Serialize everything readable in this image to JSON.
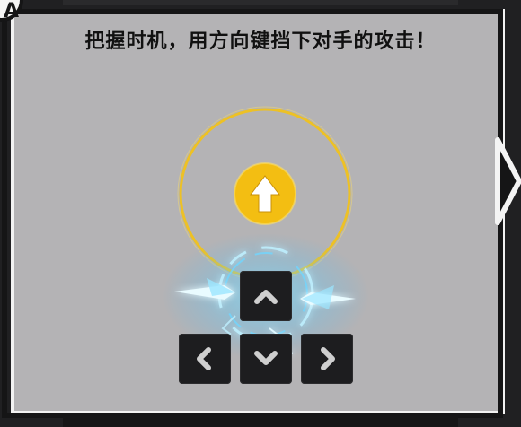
{
  "instruction": "把握时机，用方向键挡下对手的攻击！",
  "corner_badge": "A",
  "colors": {
    "panel": "#b4b3b5",
    "frame": "#151516",
    "ring": "#f0c21e",
    "prompt_button": "#f3be12",
    "key": "#1d1d1f",
    "effect": "#4fd2ff"
  },
  "prompt": {
    "direction": "up",
    "icon": "arrow-up-icon"
  },
  "keys": [
    {
      "name": "key-up",
      "icon": "chevron-up-icon"
    },
    {
      "name": "key-left",
      "icon": "chevron-left-icon"
    },
    {
      "name": "key-down",
      "icon": "chevron-down-icon"
    },
    {
      "name": "key-right",
      "icon": "chevron-right-icon"
    }
  ],
  "next_button": {
    "icon": "play-next-icon"
  }
}
